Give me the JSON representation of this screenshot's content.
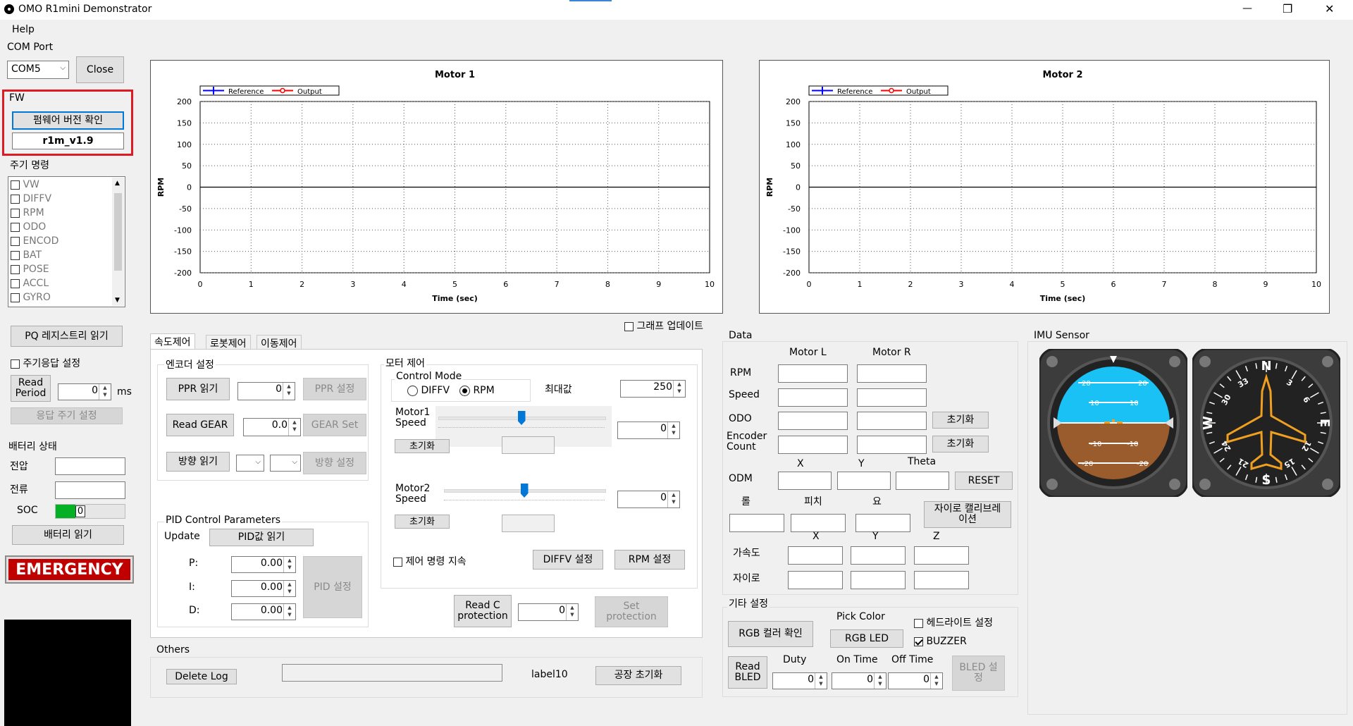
{
  "window": {
    "title": "OMO R1mini Demonstrator",
    "minimize": "—",
    "restore": "❐",
    "close": "✕"
  },
  "menu": {
    "help": "Help"
  },
  "com": {
    "label": "COM Port",
    "port": "COM5",
    "close_btn": "Close"
  },
  "fw": {
    "label": "FW",
    "check_btn": "펌웨어 버전 확인",
    "version": "r1m_v1.9"
  },
  "period": {
    "label": "주기 명령",
    "items": [
      {
        "label": "VW",
        "checked": false
      },
      {
        "label": "DIFFV",
        "checked": false
      },
      {
        "label": "RPM",
        "checked": false
      },
      {
        "label": "ODO",
        "checked": false
      },
      {
        "label": "ENCOD",
        "checked": false
      },
      {
        "label": "BAT",
        "checked": false
      },
      {
        "label": "POSE",
        "checked": false
      },
      {
        "label": "ACCL",
        "checked": false
      },
      {
        "label": "GYRO",
        "checked": false
      }
    ],
    "pq_btn": "PQ 레지스트리 읽기",
    "resp_label": "주기응답 설정",
    "read_period": "Read\nPeriod",
    "period_value": "0",
    "ms": "ms",
    "resp_set_btn": "응답 주기 설정"
  },
  "battery": {
    "label": "배터리 상태",
    "voltage": "전압",
    "current": "전류",
    "soc": "SOC",
    "soc_value": "0",
    "read_btn": "배터리 읽기"
  },
  "emergency": "EMERGENCY",
  "charts": [
    {
      "name": "Motor 1",
      "ylabel": "RPM",
      "xlabel": "Time (sec)",
      "legend": [
        "Reference",
        "Output"
      ]
    },
    {
      "name": "Motor 2",
      "ylabel": "RPM",
      "xlabel": "Time (sec)",
      "legend": [
        "Reference",
        "Output"
      ]
    }
  ],
  "chart_data": [
    {
      "type": "line",
      "title": "Motor 1",
      "xlabel": "Time (sec)",
      "ylabel": "RPM",
      "xlim": [
        0,
        10
      ],
      "ylim": [
        -200,
        200
      ],
      "xticks": [
        0,
        1,
        2,
        3,
        4,
        5,
        6,
        7,
        8,
        9,
        10
      ],
      "yticks": [
        200,
        150,
        100,
        50,
        0,
        -50,
        -100,
        -150,
        -200
      ],
      "series": [
        {
          "name": "Reference",
          "color": "#0000ff",
          "values": []
        },
        {
          "name": "Output",
          "color": "#ff0000",
          "values": []
        }
      ],
      "grid": true,
      "legend": "top-left"
    },
    {
      "type": "line",
      "title": "Motor 2",
      "xlabel": "Time (sec)",
      "ylabel": "RPM",
      "xlim": [
        0,
        10
      ],
      "ylim": [
        -200,
        200
      ],
      "xticks": [
        0,
        1,
        2,
        3,
        4,
        5,
        6,
        7,
        8,
        9,
        10
      ],
      "yticks": [
        200,
        150,
        100,
        50,
        0,
        -50,
        -100,
        -150,
        -200
      ],
      "series": [
        {
          "name": "Reference",
          "color": "#0000ff",
          "values": []
        },
        {
          "name": "Output",
          "color": "#ff0000",
          "values": []
        }
      ],
      "grid": true,
      "legend": "top-left"
    }
  ],
  "graph_update": "그래프 업데이트",
  "tabs": [
    "속도제어",
    "로봇제어",
    "이동제어"
  ],
  "encoder": {
    "label": "엔코더 설정",
    "ppr_read": "PPR 읽기",
    "ppr_value": "0",
    "ppr_set": "PPR 설정",
    "gear_read": "Read GEAR",
    "gear_value": "0.0",
    "gear_set": "GEAR Set",
    "dir_read": "방향 읽기",
    "dir_set": "방향 설정"
  },
  "pid": {
    "label": "PID Control Parameters",
    "update": "Update",
    "read_btn": "PID값 읽기",
    "p": "P:",
    "i": "I:",
    "d": "D:",
    "p_val": "0.00",
    "i_val": "0.00",
    "d_val": "0.00",
    "set_btn": "PID 설정"
  },
  "motor": {
    "label": "모터 제어",
    "mode_label": "Control Mode",
    "diffv": "DIFFV",
    "rpm": "RPM",
    "max_label": "최대값",
    "max_value": "250",
    "m1_label": "Motor1\nSpeed",
    "m1_value": "0",
    "m2_label": "Motor2\nSpeed",
    "m2_value": "0",
    "reset": "초기화",
    "keep": "제어 명령 지속",
    "diffv_set": "DIFFV 설정",
    "rpm_set": "RPM 설정",
    "m1_slider": 0.5,
    "m2_slider": 0.5
  },
  "protection": {
    "read": "Read C\nprotection",
    "value": "0",
    "set": "Set\nprotection"
  },
  "others": {
    "label": "Others",
    "delete_log": "Delete Log",
    "label10": "label10",
    "factory": "공장 초기화"
  },
  "data": {
    "label": "Data",
    "motor_l": "Motor L",
    "motor_r": "Motor R",
    "rpm": "RPM",
    "speed": "Speed",
    "odo": "ODO",
    "encoder": "Encoder\nCount",
    "reset1": "초기화",
    "reset2": "초기화",
    "x": "X",
    "y": "Y",
    "theta": "Theta",
    "odm": "ODM",
    "reset_btn": "RESET",
    "roll": "롤",
    "pitch": "피치",
    "yaw": "요",
    "gyro_cal": "자이로 캘리브레\n이션",
    "ax": "X",
    "ay": "Y",
    "az": "Z",
    "accel": "가속도",
    "gyro": "자이로"
  },
  "etc": {
    "label": "기타 설정",
    "rgb_check": "RGB 컬러 확인",
    "pick_color": "Pick Color",
    "rgb_led": "RGB LED",
    "headlight": "헤드라이트 설정",
    "buzzer": "BUZZER",
    "read_bled": "Read\nBLED",
    "duty": "Duty",
    "on_time": "On Time",
    "off_time": "Off Time",
    "duty_v": "0",
    "on_v": "0",
    "off_v": "0",
    "bled_set": "BLED 설\n정"
  },
  "imu": {
    "label": "IMU Sensor",
    "horizon": {
      "ticks": [
        "20",
        "10",
        "-10",
        "-20"
      ]
    },
    "compass": {
      "N": "N",
      "E": "E",
      "S": "S",
      "W": "W",
      "marks": [
        "3",
        "6",
        "12",
        "15",
        "21",
        "24",
        "30",
        "33"
      ]
    }
  }
}
